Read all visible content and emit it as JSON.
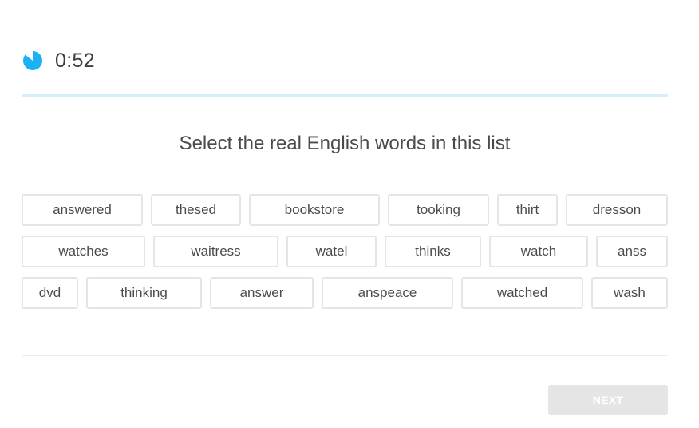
{
  "timer": {
    "value": "0:52",
    "icon": "timer-pie-icon",
    "color": "#1cb0f6",
    "remaining_fraction": 0.87
  },
  "progress": {
    "fraction": 1.0,
    "track_color": "#dff2fc"
  },
  "question": {
    "prompt": "Select the real English words in this list"
  },
  "words": {
    "row1": [
      "answered",
      "thesed",
      "bookstore",
      "tooking",
      "thirt",
      "dresson"
    ],
    "row2": [
      "watches",
      "waitress",
      "watel",
      "thinks",
      "watch",
      "anss"
    ],
    "row3": [
      "dvd",
      "thinking",
      "answer",
      "anspeace",
      "watched",
      "wash"
    ]
  },
  "footer": {
    "next_label": "NEXT",
    "next_disabled_color": "#e5e5e5"
  }
}
